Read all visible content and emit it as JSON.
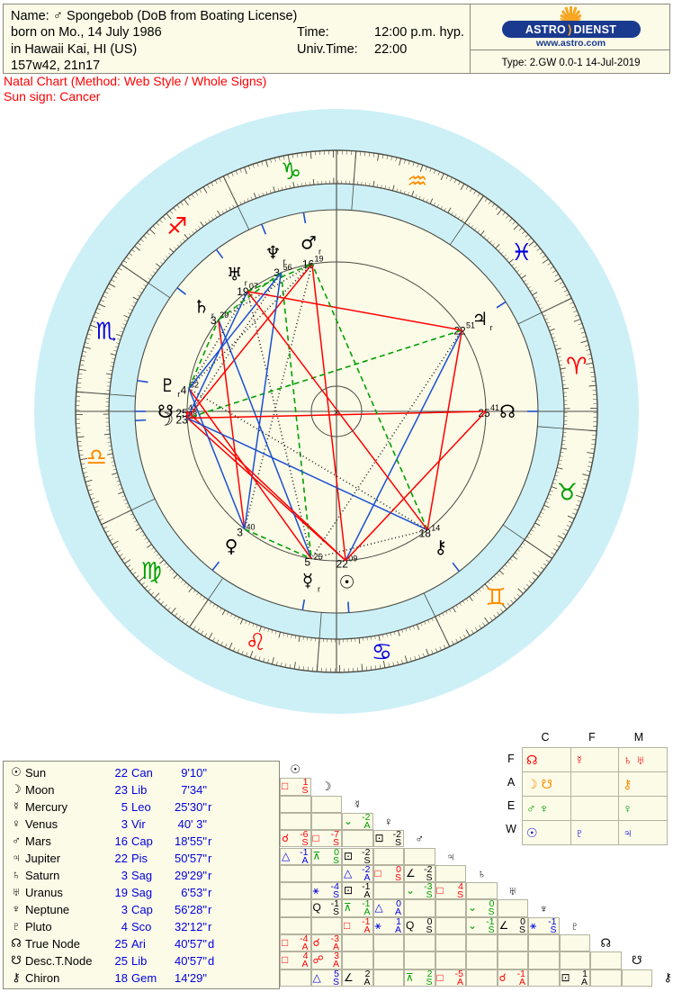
{
  "header": {
    "name_label": "Name:",
    "name_glyph": "♂",
    "name_value": "Spongebob (DoB from Boating License)",
    "born_line": "born on Mo., 14 July 1986",
    "place_line": "in Hawaii Kai, HI (US)",
    "coord_line": "157w42, 21n17",
    "time_label": "Time:",
    "time_value": "12:00 p.m. hyp.",
    "univtime_label": "Univ.Time:",
    "univtime_value": "22:00",
    "type_line": "Type: 2.GW   0.0-1  14-Jul-2019",
    "logo_astro": "ASTRO",
    "logo_paren": ")",
    "logo_dienst": "DIENST",
    "logo_url": "www.astro.com",
    "subtitle1": "Natal Chart  (Method: Web Style / Whole Signs)",
    "subtitle2": "Sun sign: Cancer"
  },
  "colors": {
    "parchment": "#fcfbe8",
    "sky": "#cdf0f7",
    "red": "#ff0000",
    "blue": "#0000e0",
    "green": "#00a000",
    "orange": "#ff8c00",
    "line": "#4a4a42"
  },
  "planets": [
    {
      "glyph": "☉",
      "name": "Sun",
      "deg": "22",
      "sign": "Can",
      "min": "9'10\"",
      "retro": ""
    },
    {
      "glyph": "☽",
      "name": "Moon",
      "deg": "23",
      "sign": "Lib",
      "min": "7'34\"",
      "retro": ""
    },
    {
      "glyph": "☿",
      "name": "Mercury",
      "deg": "5",
      "sign": "Leo",
      "min": "25'30\"",
      "retro": "r"
    },
    {
      "glyph": "♀",
      "name": "Venus",
      "deg": "3",
      "sign": "Vir",
      "min": "40' 3\"",
      "retro": ""
    },
    {
      "glyph": "♂",
      "name": "Mars",
      "deg": "16",
      "sign": "Cap",
      "min": "18'55\"",
      "retro": "r"
    },
    {
      "glyph": "♃",
      "name": "Jupiter",
      "deg": "22",
      "sign": "Pis",
      "min": "50'57\"",
      "retro": "r"
    },
    {
      "glyph": "♄",
      "name": "Saturn",
      "deg": "3",
      "sign": "Sag",
      "min": "29'29\"",
      "retro": "r"
    },
    {
      "glyph": "♅",
      "name": "Uranus",
      "deg": "19",
      "sign": "Sag",
      "min": "6'53\"",
      "retro": "r"
    },
    {
      "glyph": "♆",
      "name": "Neptune",
      "deg": "3",
      "sign": "Cap",
      "min": "56'28\"",
      "retro": "r"
    },
    {
      "glyph": "♇",
      "name": "Pluto",
      "deg": "4",
      "sign": "Sco",
      "min": "32'12\"",
      "retro": "r"
    },
    {
      "glyph": "☊",
      "name": "True Node",
      "deg": "25",
      "sign": "Ari",
      "min": "40'57\"",
      "retro": "d"
    },
    {
      "glyph": "☋",
      "name": "Desc.T.Node",
      "deg": "25",
      "sign": "Lib",
      "min": "40'57\"",
      "retro": "d"
    },
    {
      "glyph": "⚷",
      "name": "Chiron",
      "deg": "18",
      "sign": "Gem",
      "min": "14'29\"",
      "retro": ""
    }
  ],
  "elements": {
    "col_headers": [
      "C",
      "F",
      "M"
    ],
    "row_headers": [
      "F",
      "A",
      "E",
      "W"
    ],
    "rows": [
      {
        "label": "F",
        "color": "#ff0000",
        "cells": [
          [
            "☊"
          ],
          [
            "☿"
          ],
          [
            "♄",
            "♅"
          ]
        ]
      },
      {
        "label": "A",
        "color": "#ff8c00",
        "cells": [
          [
            "☽",
            "☋"
          ],
          [],
          [
            "⚷"
          ]
        ]
      },
      {
        "label": "E",
        "color": "#00a000",
        "cells": [
          [
            "♂",
            "♆"
          ],
          [],
          [
            "♀"
          ]
        ]
      },
      {
        "label": "W",
        "color": "#0000e0",
        "cells": [
          [
            "☉"
          ],
          [
            "♇"
          ],
          [
            "♃"
          ]
        ]
      }
    ]
  },
  "wheel": {
    "center_mark": "×",
    "signs": [
      {
        "name": "aries",
        "glyph": "♈",
        "color": "#ff0000"
      },
      {
        "name": "taurus",
        "glyph": "♉",
        "color": "#00a000"
      },
      {
        "name": "gemini",
        "glyph": "♊",
        "color": "#ff8c00"
      },
      {
        "name": "cancer",
        "glyph": "♋",
        "color": "#0000e0"
      },
      {
        "name": "leo",
        "glyph": "♌",
        "color": "#ff0000"
      },
      {
        "name": "virgo",
        "glyph": "♍",
        "color": "#00a000"
      },
      {
        "name": "libra",
        "glyph": "♎",
        "color": "#ff8c00"
      },
      {
        "name": "scorpio",
        "glyph": "♏",
        "color": "#0000e0"
      },
      {
        "name": "sagittarius",
        "glyph": "♐",
        "color": "#ff0000"
      },
      {
        "name": "capricorn",
        "glyph": "♑",
        "color": "#00a000"
      },
      {
        "name": "aquarius",
        "glyph": "♒",
        "color": "#ff8c00"
      },
      {
        "name": "pisces",
        "glyph": "♓",
        "color": "#0000e0"
      }
    ],
    "placements": [
      {
        "name": "mars",
        "glyph": "♂",
        "deg": "16",
        "min": "19",
        "retro": "r",
        "lon": 286.3
      },
      {
        "name": "neptune",
        "glyph": "♆",
        "deg": "3",
        "min": "56",
        "retro": "r",
        "lon": 273.9
      },
      {
        "name": "uranus",
        "glyph": "♅",
        "deg": "19",
        "min": "07",
        "retro": "r",
        "lon": 259.1
      },
      {
        "name": "saturn",
        "glyph": "♄",
        "deg": "3",
        "min": "29",
        "retro": "r",
        "lon": 243.5
      },
      {
        "name": "pluto",
        "glyph": "♇",
        "deg": "4",
        "min": "32",
        "retro": "r",
        "lon": 214.5
      },
      {
        "name": "desc-node",
        "glyph": "☋",
        "deg": "25",
        "min": "41",
        "retro": "",
        "lon": 205.7
      },
      {
        "name": "moon",
        "glyph": "☽",
        "deg": "23",
        "min": "08",
        "retro": "",
        "lon": 203.1
      },
      {
        "name": "venus",
        "glyph": "♀",
        "deg": "3",
        "min": "40",
        "retro": "",
        "lon": 153.7
      },
      {
        "name": "mercury",
        "glyph": "☿",
        "deg": "5",
        "min": "25",
        "retro": "r",
        "lon": 125.4
      },
      {
        "name": "sun",
        "glyph": "☉",
        "deg": "22",
        "min": "09",
        "retro": "",
        "lon": 112.2
      },
      {
        "name": "chiron",
        "glyph": "⚷",
        "deg": "18",
        "min": "14",
        "retro": "",
        "lon": 78.2
      },
      {
        "name": "jupiter",
        "glyph": "♃",
        "deg": "22",
        "min": "51",
        "retro": "r",
        "lon": 352.8
      },
      {
        "name": "true-node",
        "glyph": "☊",
        "deg": "25",
        "min": "41",
        "retro": "",
        "lon": 25.7
      }
    ]
  },
  "aspect_grid": {
    "planets": [
      "☉",
      "☽",
      "☿",
      "♀",
      "♂",
      "♃",
      "♄",
      "♅",
      "♆",
      "♇",
      "☊",
      "☋",
      "⚷"
    ],
    "cells": [
      {
        "r": 1,
        "c": 0,
        "sym": "□",
        "symcolor": "#ff0000",
        "num": "1",
        "orb": "S",
        "color": "#ff0000"
      },
      {
        "r": 3,
        "c": 2,
        "sym": "⌄",
        "symcolor": "#00a000",
        "num": "-2",
        "orb": "A",
        "color": "#00a000"
      },
      {
        "r": 4,
        "c": 0,
        "sym": "☌",
        "symcolor": "#ff0000",
        "num": "-6",
        "orb": "S",
        "color": "#ff0000"
      },
      {
        "r": 4,
        "c": 1,
        "sym": "□",
        "symcolor": "#ff0000",
        "num": "-7",
        "orb": "S",
        "color": "#ff0000"
      },
      {
        "r": 4,
        "c": 3,
        "sym": "⊡",
        "symcolor": "#000000",
        "num": "-2",
        "orb": "S",
        "color": "#000000"
      },
      {
        "r": 5,
        "c": 0,
        "sym": "△",
        "symcolor": "#0000e0",
        "num": "-1",
        "orb": "A",
        "color": "#0000e0"
      },
      {
        "r": 5,
        "c": 1,
        "sym": "⊼",
        "symcolor": "#00a000",
        "num": "0",
        "orb": "S",
        "color": "#00a000"
      },
      {
        "r": 5,
        "c": 2,
        "sym": "⊡",
        "symcolor": "#000000",
        "num": "-2",
        "orb": "S",
        "color": "#000000"
      },
      {
        "r": 6,
        "c": 2,
        "sym": "△",
        "symcolor": "#0000e0",
        "num": "-2",
        "orb": "A",
        "color": "#0000e0"
      },
      {
        "r": 6,
        "c": 3,
        "sym": "□",
        "symcolor": "#ff0000",
        "num": "0",
        "orb": "S",
        "color": "#ff0000"
      },
      {
        "r": 6,
        "c": 4,
        "sym": "∠",
        "symcolor": "#000000",
        "num": "-2",
        "orb": "S",
        "color": "#000000"
      },
      {
        "r": 7,
        "c": 1,
        "sym": "⚹",
        "symcolor": "#0000e0",
        "num": "-4",
        "orb": "S",
        "color": "#0000e0"
      },
      {
        "r": 7,
        "c": 2,
        "sym": "⊡",
        "symcolor": "#000000",
        "num": "-1",
        "orb": "A",
        "color": "#000000"
      },
      {
        "r": 7,
        "c": 4,
        "sym": "⌄",
        "symcolor": "#00a000",
        "num": "-3",
        "orb": "S",
        "color": "#00a000"
      },
      {
        "r": 7,
        "c": 5,
        "sym": "□",
        "symcolor": "#ff0000",
        "num": "4",
        "orb": "S",
        "color": "#ff0000"
      },
      {
        "r": 8,
        "c": 1,
        "sym": "Q",
        "symcolor": "#000000",
        "num": "-1",
        "orb": "S",
        "color": "#000000"
      },
      {
        "r": 8,
        "c": 2,
        "sym": "⊼",
        "symcolor": "#00a000",
        "num": "-1",
        "orb": "A",
        "color": "#00a000"
      },
      {
        "r": 8,
        "c": 3,
        "sym": "△",
        "symcolor": "#0000e0",
        "num": "0",
        "orb": "A",
        "color": "#0000e0"
      },
      {
        "r": 8,
        "c": 6,
        "sym": "⌄",
        "symcolor": "#00a000",
        "num": "0",
        "orb": "S",
        "color": "#00a000"
      },
      {
        "r": 9,
        "c": 2,
        "sym": "□",
        "symcolor": "#ff0000",
        "num": "-1",
        "orb": "A",
        "color": "#ff0000"
      },
      {
        "r": 9,
        "c": 3,
        "sym": "⚹",
        "symcolor": "#0000e0",
        "num": "1",
        "orb": "A",
        "color": "#0000e0"
      },
      {
        "r": 9,
        "c": 4,
        "sym": "Q",
        "symcolor": "#000000",
        "num": "0",
        "orb": "S",
        "color": "#000000"
      },
      {
        "r": 9,
        "c": 6,
        "sym": "⌄",
        "symcolor": "#00a000",
        "num": "-1",
        "orb": "S",
        "color": "#00a000"
      },
      {
        "r": 9,
        "c": 7,
        "sym": "∠",
        "symcolor": "#000000",
        "num": "0",
        "orb": "S",
        "color": "#000000"
      },
      {
        "r": 9,
        "c": 8,
        "sym": "⚹",
        "symcolor": "#0000e0",
        "num": "-1",
        "orb": "S",
        "color": "#0000e0"
      },
      {
        "r": 10,
        "c": 0,
        "sym": "□",
        "symcolor": "#ff0000",
        "num": "-4",
        "orb": "A",
        "color": "#ff0000"
      },
      {
        "r": 10,
        "c": 1,
        "sym": "☌",
        "symcolor": "#ff0000",
        "num": "-3",
        "orb": "A",
        "color": "#ff0000"
      },
      {
        "r": 11,
        "c": 0,
        "sym": "□",
        "symcolor": "#ff0000",
        "num": "4",
        "orb": "A",
        "color": "#ff0000"
      },
      {
        "r": 11,
        "c": 1,
        "sym": "☍",
        "symcolor": "#ff0000",
        "num": "3",
        "orb": "A",
        "color": "#ff0000"
      },
      {
        "r": 12,
        "c": 1,
        "sym": "△",
        "symcolor": "#0000e0",
        "num": "5",
        "orb": "S",
        "color": "#0000e0"
      },
      {
        "r": 12,
        "c": 2,
        "sym": "∠",
        "symcolor": "#000000",
        "num": "2",
        "orb": "A",
        "color": "#000000"
      },
      {
        "r": 12,
        "c": 4,
        "sym": "⊼",
        "symcolor": "#00a000",
        "num": "2",
        "orb": "S",
        "color": "#00a000"
      },
      {
        "r": 12,
        "c": 5,
        "sym": "□",
        "symcolor": "#ff0000",
        "num": "-5",
        "orb": "A",
        "color": "#ff0000"
      },
      {
        "r": 12,
        "c": 7,
        "sym": "☌",
        "symcolor": "#ff0000",
        "num": "-1",
        "orb": "A",
        "color": "#ff0000"
      },
      {
        "r": 12,
        "c": 9,
        "sym": "⊡",
        "symcolor": "#000000",
        "num": "1",
        "orb": "A",
        "color": "#000000"
      }
    ]
  }
}
